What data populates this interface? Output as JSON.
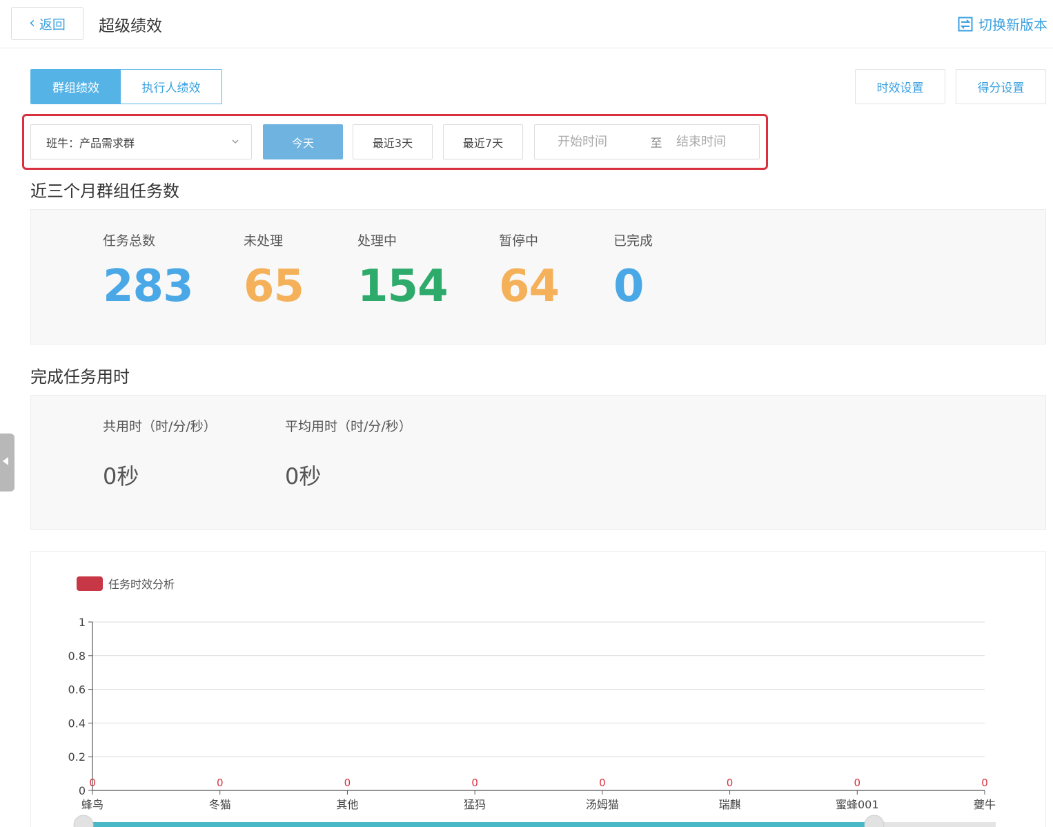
{
  "header": {
    "back_label": "返回",
    "title": "超级绩效",
    "switch_label": "切换新版本",
    "accent_color": "#3aa0e0"
  },
  "tabs": [
    {
      "label": "群组绩效",
      "active": true
    },
    {
      "label": "执行人绩效",
      "active": false
    }
  ],
  "settings": {
    "timeliness_label": "时效设置",
    "score_label": "得分设置"
  },
  "filters": {
    "group_select": "班牛：产品需求群",
    "ranges": [
      {
        "label": "今天",
        "active": true
      },
      {
        "label": "最近3天",
        "active": false
      },
      {
        "label": "最近7天",
        "active": false
      }
    ],
    "start_placeholder": "开始时间",
    "separator": "至",
    "end_placeholder": "结束时间"
  },
  "task_section": {
    "title": "近三个月群组任务数",
    "stats": [
      {
        "label": "任务总数",
        "value": "283",
        "color": "#4aa8e6"
      },
      {
        "label": "未处理",
        "value": "65",
        "color": "#f4b15a"
      },
      {
        "label": "处理中",
        "value": "154",
        "color": "#2eaa6b"
      },
      {
        "label": "暂停中",
        "value": "64",
        "color": "#f4b15a"
      },
      {
        "label": "已完成",
        "value": "0",
        "color": "#4aa8e6"
      }
    ]
  },
  "time_section": {
    "title": "完成任务用时",
    "stats": [
      {
        "label": "共用时（时/分/秒）",
        "value": "0秒"
      },
      {
        "label": "平均用时（时/分/秒）",
        "value": "0秒"
      }
    ]
  },
  "chart_data": {
    "type": "bar",
    "legend": [
      {
        "name": "任务时效分析",
        "color": "#c73745"
      }
    ],
    "legend_position": "top-left",
    "categories": [
      "蜂鸟",
      "冬猫",
      "其他",
      "猛犸",
      "汤姆猫",
      "瑞麒",
      "蜜蜂001",
      "夔牛"
    ],
    "series": [
      {
        "name": "任务时效分析",
        "values": [
          0,
          0,
          0,
          0,
          0,
          0,
          0,
          0
        ],
        "color": "#c73745"
      }
    ],
    "ylim": [
      0,
      1
    ],
    "yticks": [
      "0",
      "0.2",
      "0.4",
      "0.6",
      "0.8",
      "1"
    ],
    "grid": true,
    "data_labels": [
      "0",
      "0",
      "0",
      "0",
      "0",
      "0",
      "0",
      "0"
    ]
  }
}
